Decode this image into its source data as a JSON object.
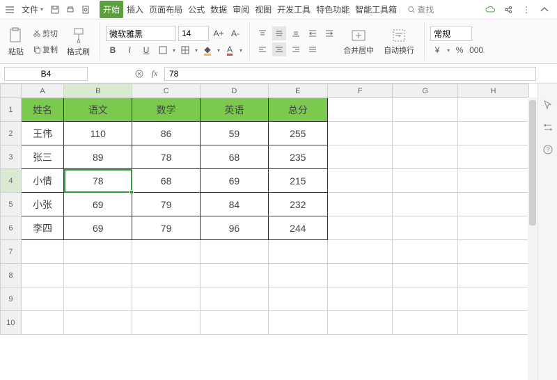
{
  "menu": {
    "file": "文件",
    "tabs": [
      "开始",
      "插入",
      "页面布局",
      "公式",
      "数据",
      "审阅",
      "视图",
      "开发工具",
      "特色功能",
      "智能工具箱"
    ],
    "active_tab": 0,
    "search_placeholder": "查找"
  },
  "ribbon": {
    "paste": "粘贴",
    "cut": "剪切",
    "copy": "复制",
    "format_painter": "格式刷",
    "font_name": "微软雅黑",
    "font_size": "14",
    "merge_center": "合并居中",
    "wrap_text": "自动换行",
    "num_category": "常规",
    "currency": "¥",
    "percent": "%",
    "thousand": "000",
    "A_plus": "A+",
    "A_minus": "A-"
  },
  "fxbar": {
    "name_box": "B4",
    "formula": "78"
  },
  "sheet": {
    "col_headers": [
      "A",
      "B",
      "C",
      "D",
      "E",
      "F",
      "G",
      "H"
    ],
    "row_headers": [
      "1",
      "2",
      "3",
      "4",
      "5",
      "6",
      "7",
      "8",
      "9",
      "10"
    ],
    "selected_col": 1,
    "selected_row": 3,
    "header_row": [
      "姓名",
      "语文",
      "数学",
      "英语",
      "总分"
    ],
    "rows": [
      [
        "王伟",
        "110",
        "86",
        "59",
        "255"
      ],
      [
        "张三",
        "89",
        "78",
        "68",
        "235"
      ],
      [
        "小倩",
        "78",
        "68",
        "69",
        "215"
      ],
      [
        "小张",
        "69",
        "79",
        "84",
        "232"
      ],
      [
        "李四",
        "69",
        "79",
        "96",
        "244"
      ]
    ]
  }
}
